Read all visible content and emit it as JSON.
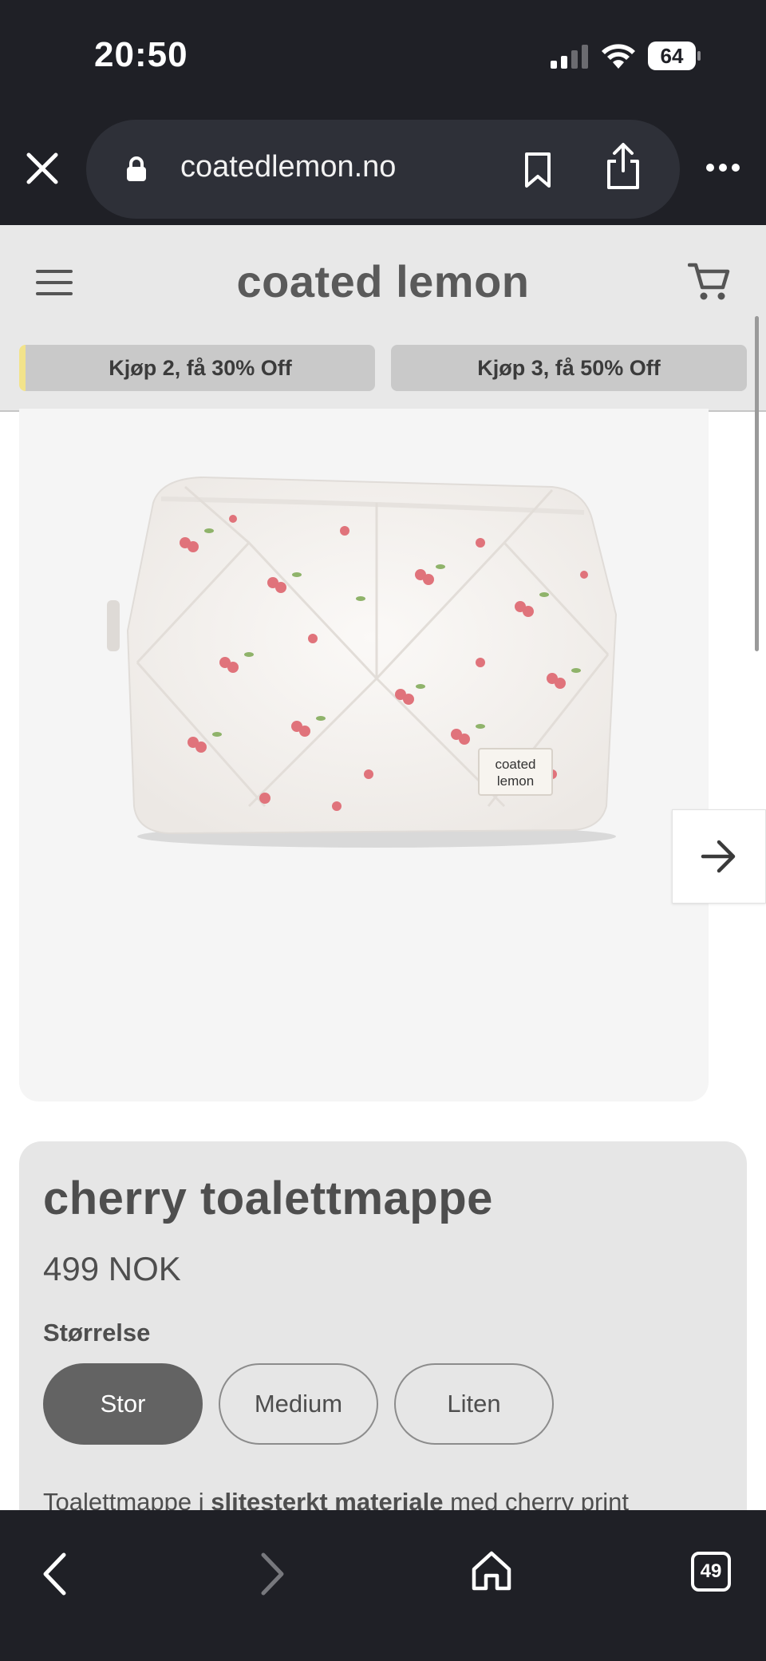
{
  "status_bar": {
    "time": "20:50",
    "battery": "64"
  },
  "browser": {
    "url": "coatedlemon.no",
    "tab_count": "49"
  },
  "header": {
    "logo": "coated lemon",
    "promos": [
      "Kjøp 2, få 30% Off",
      "Kjøp 3, få 50% Off"
    ]
  },
  "product": {
    "image_alt": "cherry print quilted toiletry bag with coated lemon label",
    "label_line1": "coated",
    "label_line2": "lemon",
    "title": "cherry toalettmappe",
    "price": "499 NOK",
    "size_label": "Størrelse",
    "sizes": [
      "Stor",
      "Medium",
      "Liten"
    ],
    "selected_size": "Stor",
    "description_start": "Toalettmappe i ",
    "description_bold": "slitesterkt materiale",
    "description_end": " med cherry print"
  },
  "colors": {
    "browser_chrome": "#1f2026",
    "header_bg": "#e8e8e8",
    "promo_bg": "#c9c9c9",
    "promo_accent": "#f2e38b",
    "selected_size_bg": "#636363"
  }
}
